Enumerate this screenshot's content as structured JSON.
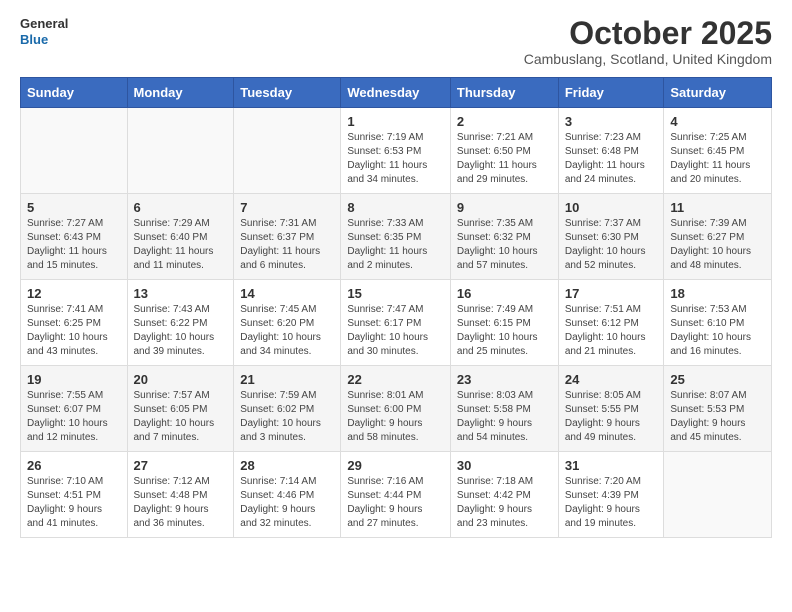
{
  "header": {
    "logo_general": "General",
    "logo_blue": "Blue",
    "month": "October 2025",
    "location": "Cambuslang, Scotland, United Kingdom"
  },
  "weekdays": [
    "Sunday",
    "Monday",
    "Tuesday",
    "Wednesday",
    "Thursday",
    "Friday",
    "Saturday"
  ],
  "weeks": [
    [
      {
        "day": "",
        "info": ""
      },
      {
        "day": "",
        "info": ""
      },
      {
        "day": "",
        "info": ""
      },
      {
        "day": "1",
        "info": "Sunrise: 7:19 AM\nSunset: 6:53 PM\nDaylight: 11 hours\nand 34 minutes."
      },
      {
        "day": "2",
        "info": "Sunrise: 7:21 AM\nSunset: 6:50 PM\nDaylight: 11 hours\nand 29 minutes."
      },
      {
        "day": "3",
        "info": "Sunrise: 7:23 AM\nSunset: 6:48 PM\nDaylight: 11 hours\nand 24 minutes."
      },
      {
        "day": "4",
        "info": "Sunrise: 7:25 AM\nSunset: 6:45 PM\nDaylight: 11 hours\nand 20 minutes."
      }
    ],
    [
      {
        "day": "5",
        "info": "Sunrise: 7:27 AM\nSunset: 6:43 PM\nDaylight: 11 hours\nand 15 minutes."
      },
      {
        "day": "6",
        "info": "Sunrise: 7:29 AM\nSunset: 6:40 PM\nDaylight: 11 hours\nand 11 minutes."
      },
      {
        "day": "7",
        "info": "Sunrise: 7:31 AM\nSunset: 6:37 PM\nDaylight: 11 hours\nand 6 minutes."
      },
      {
        "day": "8",
        "info": "Sunrise: 7:33 AM\nSunset: 6:35 PM\nDaylight: 11 hours\nand 2 minutes."
      },
      {
        "day": "9",
        "info": "Sunrise: 7:35 AM\nSunset: 6:32 PM\nDaylight: 10 hours\nand 57 minutes."
      },
      {
        "day": "10",
        "info": "Sunrise: 7:37 AM\nSunset: 6:30 PM\nDaylight: 10 hours\nand 52 minutes."
      },
      {
        "day": "11",
        "info": "Sunrise: 7:39 AM\nSunset: 6:27 PM\nDaylight: 10 hours\nand 48 minutes."
      }
    ],
    [
      {
        "day": "12",
        "info": "Sunrise: 7:41 AM\nSunset: 6:25 PM\nDaylight: 10 hours\nand 43 minutes."
      },
      {
        "day": "13",
        "info": "Sunrise: 7:43 AM\nSunset: 6:22 PM\nDaylight: 10 hours\nand 39 minutes."
      },
      {
        "day": "14",
        "info": "Sunrise: 7:45 AM\nSunset: 6:20 PM\nDaylight: 10 hours\nand 34 minutes."
      },
      {
        "day": "15",
        "info": "Sunrise: 7:47 AM\nSunset: 6:17 PM\nDaylight: 10 hours\nand 30 minutes."
      },
      {
        "day": "16",
        "info": "Sunrise: 7:49 AM\nSunset: 6:15 PM\nDaylight: 10 hours\nand 25 minutes."
      },
      {
        "day": "17",
        "info": "Sunrise: 7:51 AM\nSunset: 6:12 PM\nDaylight: 10 hours\nand 21 minutes."
      },
      {
        "day": "18",
        "info": "Sunrise: 7:53 AM\nSunset: 6:10 PM\nDaylight: 10 hours\nand 16 minutes."
      }
    ],
    [
      {
        "day": "19",
        "info": "Sunrise: 7:55 AM\nSunset: 6:07 PM\nDaylight: 10 hours\nand 12 minutes."
      },
      {
        "day": "20",
        "info": "Sunrise: 7:57 AM\nSunset: 6:05 PM\nDaylight: 10 hours\nand 7 minutes."
      },
      {
        "day": "21",
        "info": "Sunrise: 7:59 AM\nSunset: 6:02 PM\nDaylight: 10 hours\nand 3 minutes."
      },
      {
        "day": "22",
        "info": "Sunrise: 8:01 AM\nSunset: 6:00 PM\nDaylight: 9 hours\nand 58 minutes."
      },
      {
        "day": "23",
        "info": "Sunrise: 8:03 AM\nSunset: 5:58 PM\nDaylight: 9 hours\nand 54 minutes."
      },
      {
        "day": "24",
        "info": "Sunrise: 8:05 AM\nSunset: 5:55 PM\nDaylight: 9 hours\nand 49 minutes."
      },
      {
        "day": "25",
        "info": "Sunrise: 8:07 AM\nSunset: 5:53 PM\nDaylight: 9 hours\nand 45 minutes."
      }
    ],
    [
      {
        "day": "26",
        "info": "Sunrise: 7:10 AM\nSunset: 4:51 PM\nDaylight: 9 hours\nand 41 minutes."
      },
      {
        "day": "27",
        "info": "Sunrise: 7:12 AM\nSunset: 4:48 PM\nDaylight: 9 hours\nand 36 minutes."
      },
      {
        "day": "28",
        "info": "Sunrise: 7:14 AM\nSunset: 4:46 PM\nDaylight: 9 hours\nand 32 minutes."
      },
      {
        "day": "29",
        "info": "Sunrise: 7:16 AM\nSunset: 4:44 PM\nDaylight: 9 hours\nand 27 minutes."
      },
      {
        "day": "30",
        "info": "Sunrise: 7:18 AM\nSunset: 4:42 PM\nDaylight: 9 hours\nand 23 minutes."
      },
      {
        "day": "31",
        "info": "Sunrise: 7:20 AM\nSunset: 4:39 PM\nDaylight: 9 hours\nand 19 minutes."
      },
      {
        "day": "",
        "info": ""
      }
    ]
  ]
}
